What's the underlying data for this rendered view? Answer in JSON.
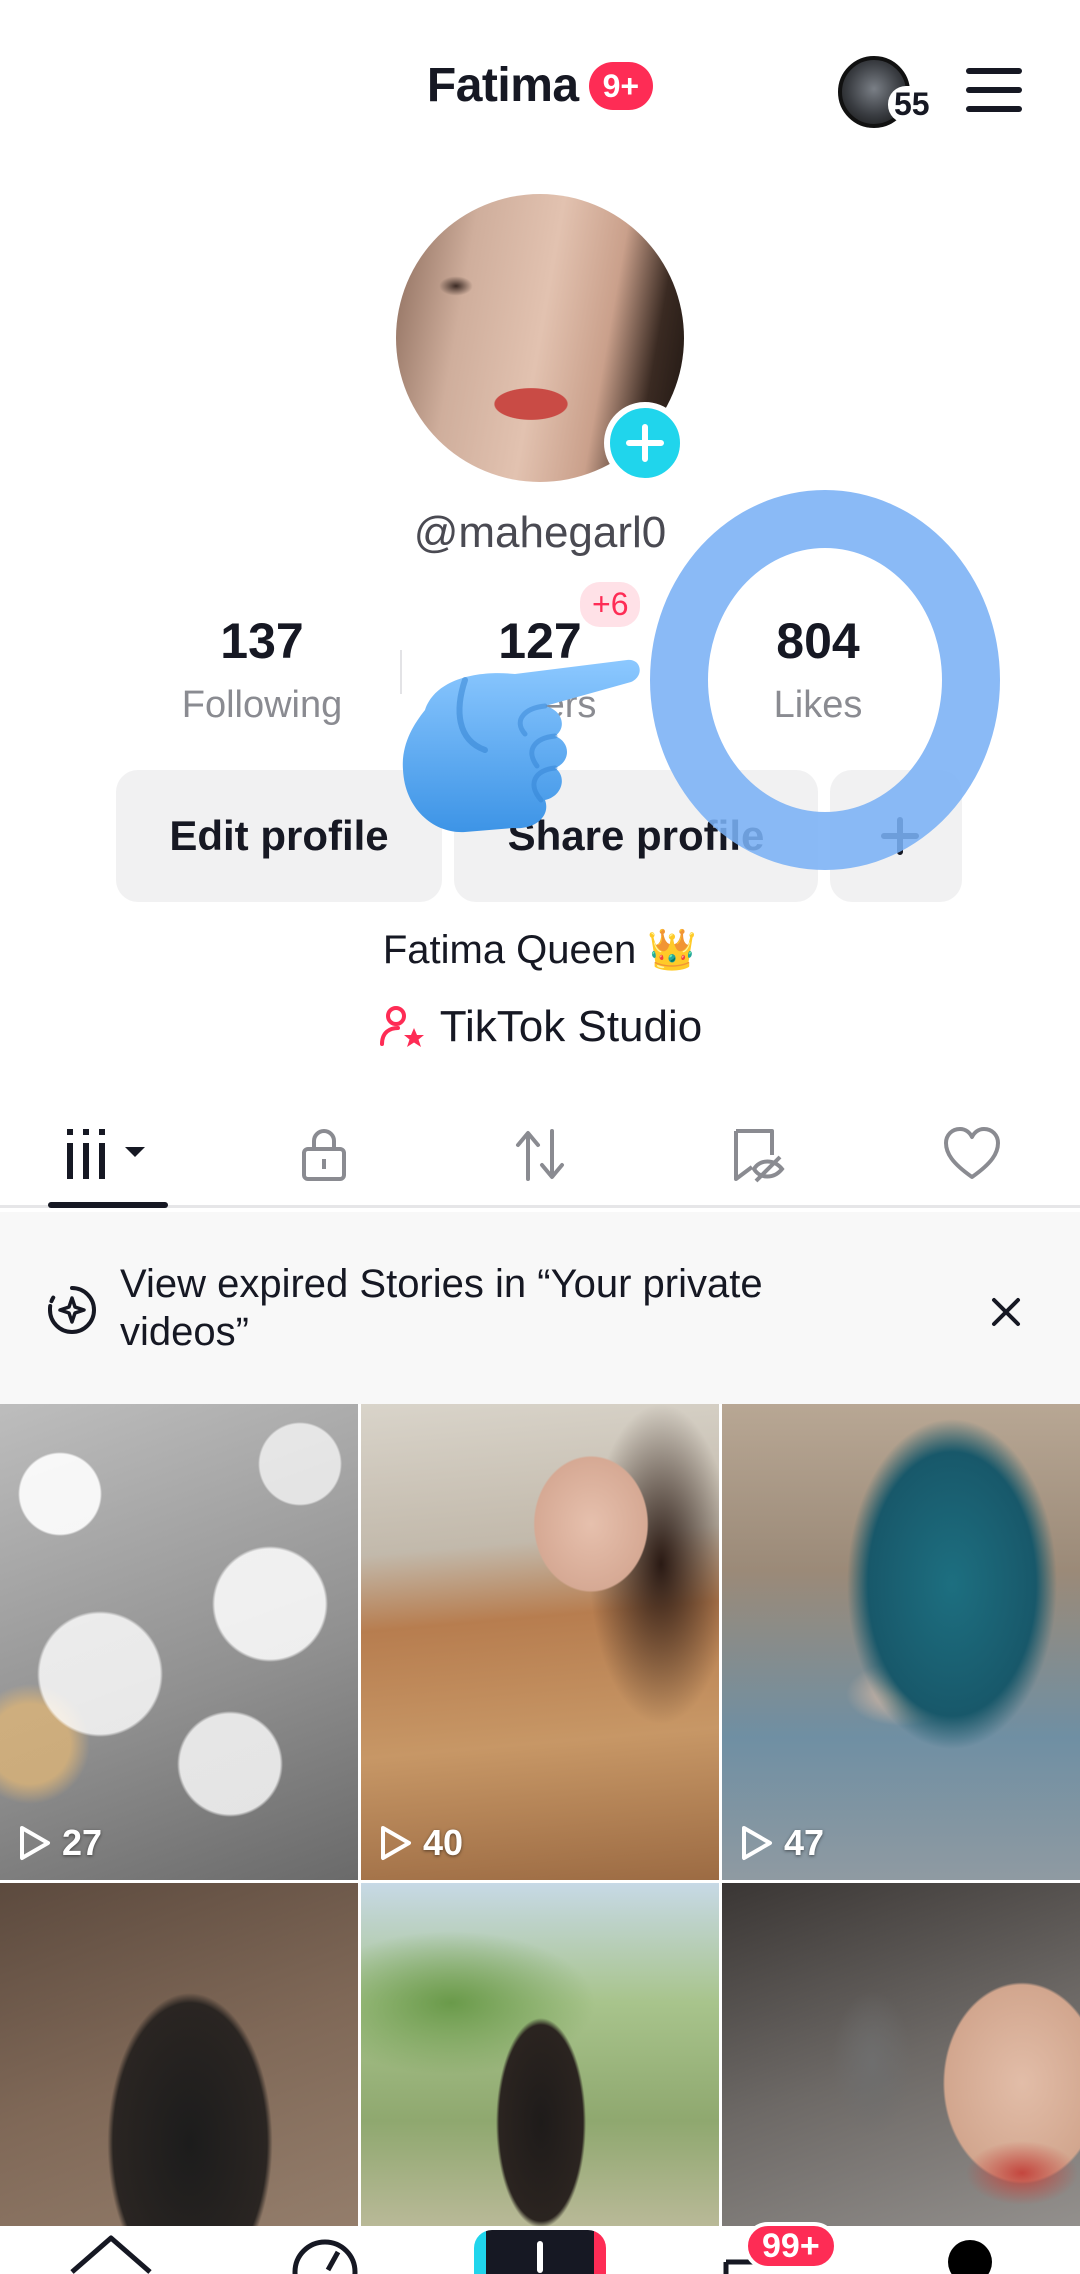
{
  "header": {
    "name": "Fatima",
    "notification_badge": "9+",
    "friends_count": "55"
  },
  "profile": {
    "username": "@mahegarl0",
    "stats": {
      "following_value": "137",
      "following_label": "Following",
      "followers_value": "127",
      "followers_label_visible": "ers",
      "followers_new_badge": "+6",
      "likes_value": "804",
      "likes_label": "Likes"
    },
    "buttons": {
      "edit": "Edit profile",
      "share": "Share profile"
    },
    "bio": "Fatima Queen 👑",
    "studio_label": "TikTok Studio"
  },
  "tabs": [
    {
      "id": "videos",
      "icon": "grid-icon",
      "active": true
    },
    {
      "id": "private",
      "icon": "lock-icon"
    },
    {
      "id": "reposts",
      "icon": "repost-icon"
    },
    {
      "id": "favorites",
      "icon": "bookmark-eye-icon"
    },
    {
      "id": "liked",
      "icon": "heart-icon"
    }
  ],
  "banner": {
    "text": "View expired Stories in “Your private videos”"
  },
  "videos": [
    {
      "views": "27"
    },
    {
      "views": "40"
    },
    {
      "views": "47"
    },
    {
      "views": ""
    },
    {
      "views": ""
    },
    {
      "views": ""
    }
  ],
  "bottom_nav": {
    "inbox_badge": "99+"
  },
  "colors": {
    "accent_pink": "#fe2c55",
    "accent_cyan": "#20d5ec",
    "overlay_blue": "#7ab0f5"
  }
}
